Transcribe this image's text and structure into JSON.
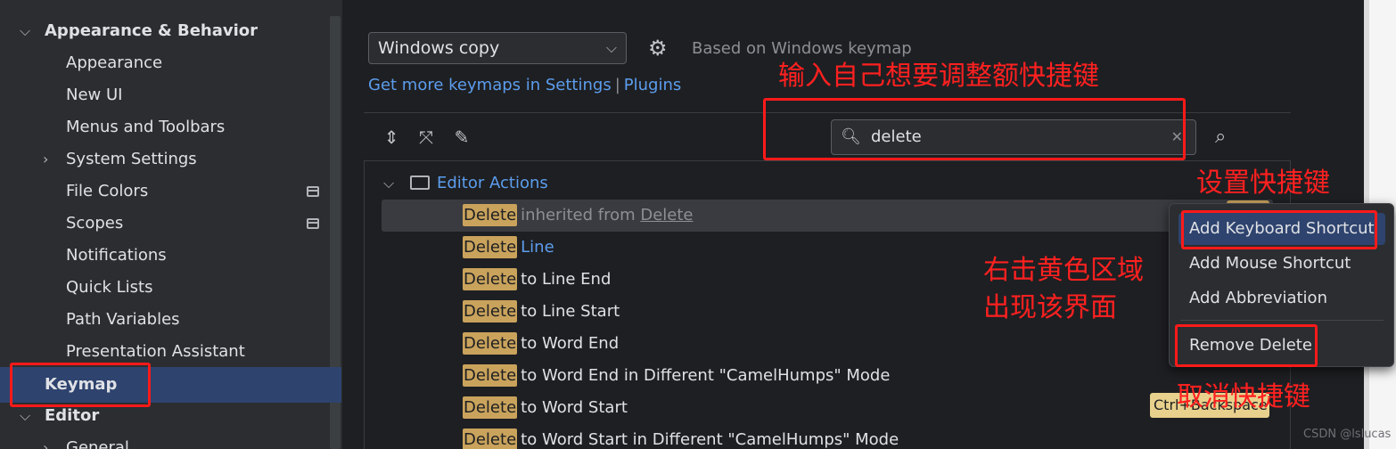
{
  "sidebar": {
    "items": [
      {
        "label": "Appearance & Behavior",
        "expanded": true
      },
      {
        "label": "Appearance"
      },
      {
        "label": "New UI"
      },
      {
        "label": "Menus and Toolbars"
      },
      {
        "label": "System Settings",
        "expandable": true
      },
      {
        "label": "File Colors",
        "icon": "project-level-icon"
      },
      {
        "label": "Scopes",
        "icon": "project-level-icon"
      },
      {
        "label": "Notifications"
      },
      {
        "label": "Quick Lists"
      },
      {
        "label": "Path Variables"
      },
      {
        "label": "Presentation Assistant"
      },
      {
        "label": "Keymap",
        "selected": true
      },
      {
        "label": "Editor",
        "expanded": true
      },
      {
        "label": "General",
        "expandable": true
      }
    ]
  },
  "keymap": {
    "selected": "Windows copy",
    "based_on": "Based on Windows keymap",
    "link_settings": "Get more keymaps in Settings",
    "link_sep": "|",
    "link_plugins": "Plugins"
  },
  "search": {
    "value": "delete"
  },
  "tree": {
    "group": "Editor Actions",
    "match": "Delete",
    "rows": [
      {
        "rest": "inherited from ",
        "link": "Delete",
        "style": "gray"
      },
      {
        "rest": "Line",
        "style": "blue"
      },
      {
        "rest": "to Line End"
      },
      {
        "rest": "to Line Start"
      },
      {
        "rest": "to Word End"
      },
      {
        "rest": "to Word End in Different \"CamelHumps\" Mode"
      },
      {
        "rest": "to Word Start"
      },
      {
        "rest": "to Word Start in Different \"CamelHumps\" Mode"
      }
    ],
    "shortcut": "Ctrl+Backspace"
  },
  "context_menu": {
    "items": [
      "Add Keyboard Shortcut",
      "Add Mouse Shortcut",
      "Add Abbreviation",
      "Remove Delete"
    ]
  },
  "annotations": {
    "search_hint": "输入自己想要调整额快捷键",
    "set_shortcut": "设置快捷键",
    "right_click_1": "右击黄色区域",
    "right_click_2": "出现该界面",
    "cancel_shortcut": "取消快捷键"
  },
  "watermark": "CSDN @lslucas",
  "colors": {
    "accent_link": "#5c9ded",
    "highlight": "#c9a35c",
    "annotation": "#ff1a1a",
    "selection": "#2e436e"
  }
}
